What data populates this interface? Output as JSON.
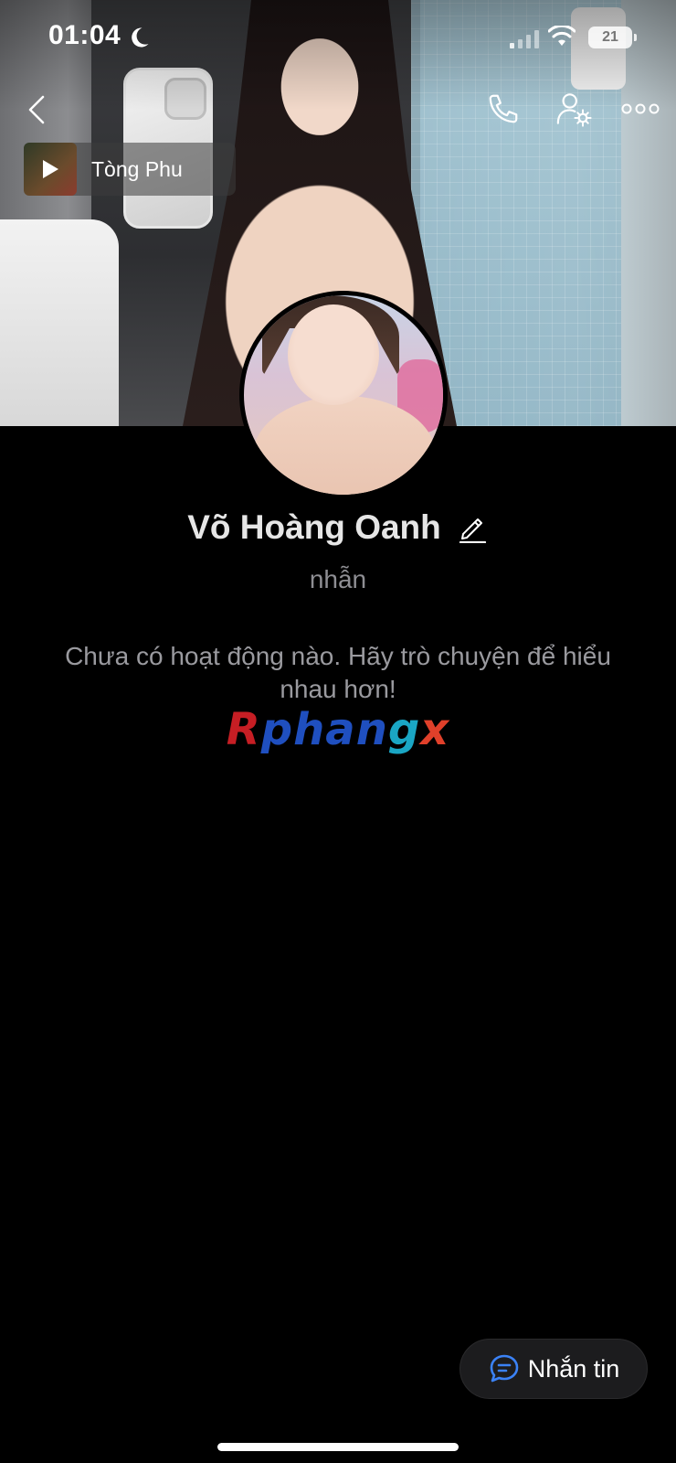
{
  "status_bar": {
    "time": "01:04",
    "battery": "21"
  },
  "cover": {
    "music": {
      "title": "Tòng Phu"
    }
  },
  "profile": {
    "name": "Võ Hoàng Oanh",
    "bio": "nhẫn",
    "empty_activity": "Chưa có hoạt động nào. Hãy trò chuyện để hiểu nhau hơn!"
  },
  "watermark": {
    "part1": "R",
    "part2": "phan",
    "part3": "g",
    "part4": "x"
  },
  "actions": {
    "message_label": "Nhắn tin"
  },
  "icons": {
    "back": "chevron-left-icon",
    "call": "phone-icon",
    "settings": "user-gear-icon",
    "more": "more-horizontal-icon",
    "play": "play-icon",
    "edit": "pencil-icon",
    "chat": "chat-bubble-icon",
    "moon": "moon-icon",
    "signal": "signal-icon",
    "wifi": "wifi-icon",
    "battery": "battery-icon"
  },
  "colors": {
    "background": "#000000",
    "accent": "#3b82f6",
    "muted_text": "#8e8e93",
    "button_bg": "#1c1c1e"
  }
}
